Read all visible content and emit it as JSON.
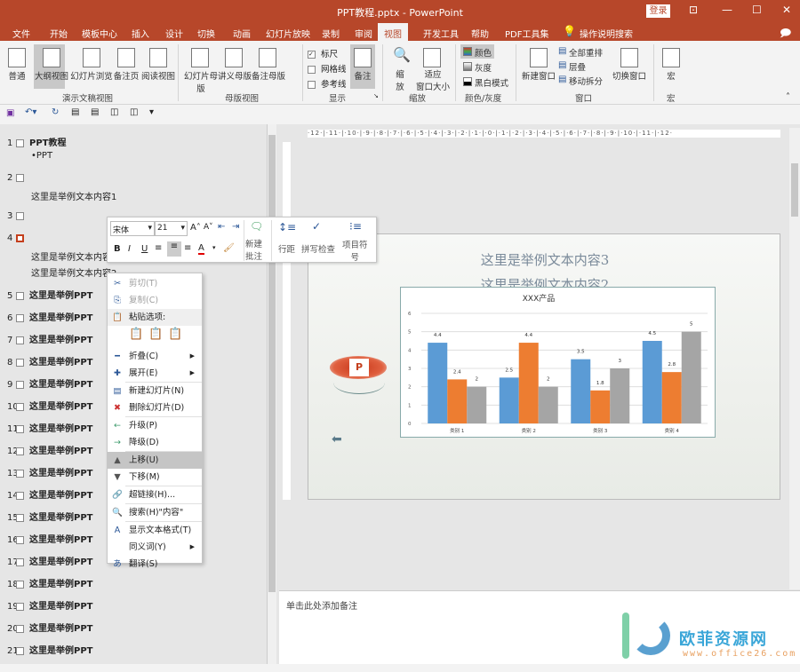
{
  "window": {
    "title": "PPT教程.pptx  -  PowerPoint",
    "login": "登录"
  },
  "tabs": [
    "文件",
    "开始",
    "模板中心",
    "插入",
    "设计",
    "切换",
    "动画",
    "幻灯片放映",
    "录制",
    "审阅",
    "视图",
    "开发工具",
    "帮助",
    "PDF工具集",
    "操作说明搜索"
  ],
  "active_tab": "视图",
  "ribbon": {
    "presentation_views": [
      "普通",
      "大纲视图",
      "幻灯片浏览",
      "备注页",
      "阅读视图"
    ],
    "master_views": [
      "幻灯片母版",
      "讲义母版",
      "备注母版"
    ],
    "show": {
      "ruler": "标尺",
      "gridlines": "网格线",
      "guides": "参考线",
      "notes": "备注",
      "ruler_checked": true,
      "gridlines_checked": false,
      "guides_checked": false
    },
    "zoom": [
      "缩\n放",
      "适应\n窗口大小"
    ],
    "color": [
      "颜色",
      "灰度",
      "黑白模式"
    ],
    "window": [
      "新建窗口",
      "全部重排",
      "层叠",
      "移动拆分",
      "切换窗口"
    ],
    "macro": "宏",
    "groups": [
      "演示文稿视图",
      "母版视图",
      "显示",
      "缩放",
      "颜色/灰度",
      "窗口",
      "宏"
    ]
  },
  "outline": {
    "items": [
      {
        "num": "1",
        "title": "PPT教程",
        "sub": [
          "•PPT"
        ]
      },
      {
        "num": "2",
        "title": "",
        "sub": [
          "这里是举例文本内容1"
        ]
      },
      {
        "num": "3",
        "title": "",
        "sub": []
      },
      {
        "num": "4",
        "title": "",
        "sub": [
          "这里是举例文本内容3",
          "这里是举例文本内容2"
        ]
      },
      {
        "num": "5",
        "title": "这里是举例PPT"
      },
      {
        "num": "6",
        "title": "这里是举例PPT"
      },
      {
        "num": "7",
        "title": "这里是举例PPT"
      },
      {
        "num": "8",
        "title": "这里是举例PPT"
      },
      {
        "num": "9",
        "title": "这里是举例PPT"
      },
      {
        "num": "10",
        "title": "这里是举例PPT"
      },
      {
        "num": "11",
        "title": "这里是举例PPT"
      },
      {
        "num": "12",
        "title": "这里是举例PPT"
      },
      {
        "num": "13",
        "title": "这里是举例PPT"
      },
      {
        "num": "14",
        "title": "这里是举例PPT"
      },
      {
        "num": "15",
        "title": "这里是举例PPT"
      },
      {
        "num": "16",
        "title": "这里是举例PPT"
      },
      {
        "num": "17",
        "title": "这里是举例PPT"
      },
      {
        "num": "18",
        "title": "这里是举例PPT"
      },
      {
        "num": "19",
        "title": "这里是举例PPT"
      },
      {
        "num": "20",
        "title": "这里是举例PPT"
      },
      {
        "num": "21",
        "title": "这里是举例PPT"
      }
    ]
  },
  "mini_toolbar": {
    "font": "宋体",
    "size": "21",
    "new_comment": "新建\n批注",
    "line_spacing": "行距",
    "spell_check": "拼写检查",
    "bullets": "项目符\n号"
  },
  "context_menu": [
    {
      "icon": "cut-icon",
      "label": "剪切(T)",
      "disabled": true
    },
    {
      "icon": "copy-icon",
      "label": "复制(C)",
      "disabled": true
    },
    {
      "icon": "paste-icon",
      "label": "粘贴选项:",
      "header": true
    },
    {
      "icon": "collapse-icon",
      "label": "折叠(C)",
      "submenu": true
    },
    {
      "icon": "expand-icon",
      "label": "展开(E)",
      "submenu": true
    },
    {
      "icon": "new-slide-icon",
      "label": "新建幻灯片(N)"
    },
    {
      "icon": "delete-slide-icon",
      "label": "删除幻灯片(D)"
    },
    {
      "icon": "promote-icon",
      "label": "升级(P)"
    },
    {
      "icon": "demote-icon",
      "label": "降级(D)"
    },
    {
      "icon": "move-up-icon",
      "label": "上移(U)",
      "highlighted": true
    },
    {
      "icon": "move-down-icon",
      "label": "下移(M)"
    },
    {
      "icon": "hyperlink-icon",
      "label": "超链接(H)..."
    },
    {
      "icon": "search-icon",
      "label": "搜索(H)\"内容\""
    },
    {
      "icon": "text-format-icon",
      "label": "显示文本格式(T)"
    },
    {
      "icon": "",
      "label": "同义词(Y)",
      "submenu": true
    },
    {
      "icon": "translate-icon",
      "label": "翻译(S)"
    }
  ],
  "slide": {
    "line1": "这里是举例文本内容3",
    "line2": "这里是举例文本内容2"
  },
  "notes_placeholder": "单击此处添加备注",
  "watermark": {
    "name": "欧菲资源网",
    "url": "www.office26.com"
  },
  "chart_data": {
    "type": "bar",
    "title": "XXX产品",
    "categories": [
      "类别 1",
      "类别 2",
      "类别 3",
      "类别 4"
    ],
    "series": [
      {
        "values": [
          4.4,
          2.5,
          3.5,
          4.5
        ],
        "color": "#5b9bd5"
      },
      {
        "values": [
          2.4,
          4.4,
          1.8,
          2.8
        ],
        "color": "#ed7d31"
      },
      {
        "values": [
          2,
          2,
          3,
          5
        ],
        "color": "#a5a5a5"
      }
    ],
    "ylim": [
      0,
      6
    ],
    "yticks": [
      0,
      1,
      2,
      3,
      4,
      5,
      6
    ],
    "grid": true,
    "data_labels": true
  }
}
